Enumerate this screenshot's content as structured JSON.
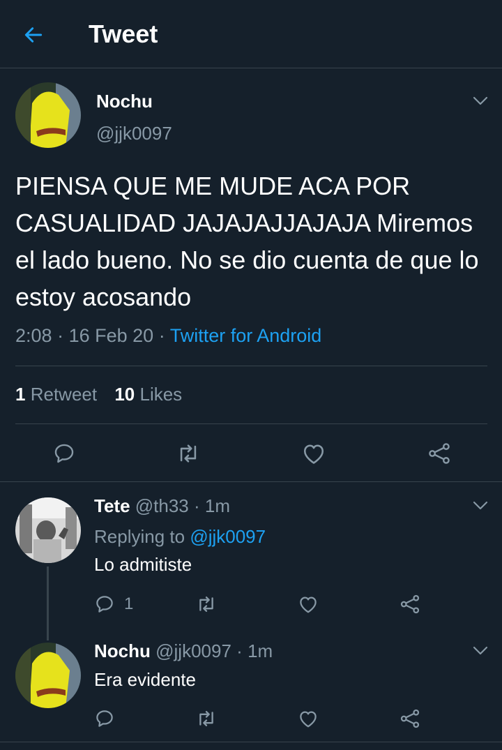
{
  "header": {
    "title": "Tweet",
    "back_icon": "arrow-left-icon"
  },
  "colors": {
    "background": "#15202b",
    "accent": "#1da1f2",
    "muted": "#8899a6",
    "divider": "#38444d"
  },
  "tweet": {
    "author_name": "Nochu",
    "author_handle": "@jjk0097",
    "text": "PIENSA QUE ME MUDE ACA POR CASUALIDAD JAJAJAJJAJAJA Miremos el lado bueno. No se dio cuenta de que lo estoy acosando",
    "time": "2:08",
    "date": "16 Feb 20",
    "source": "Twitter for Android",
    "retweets_count": "1",
    "retweets_label": "Retweet",
    "likes_count": "10",
    "likes_label": "Likes"
  },
  "replies": [
    {
      "name": "Tete",
      "handle": "@th33",
      "time": "1m",
      "replying_label": "Replying to",
      "replying_to": "@jjk0097",
      "text": "Lo admitiste",
      "reply_count": "1"
    },
    {
      "name": "Nochu",
      "handle": "@jjk0097",
      "time": "1m",
      "text": "Era evidente"
    }
  ],
  "separator": "·"
}
